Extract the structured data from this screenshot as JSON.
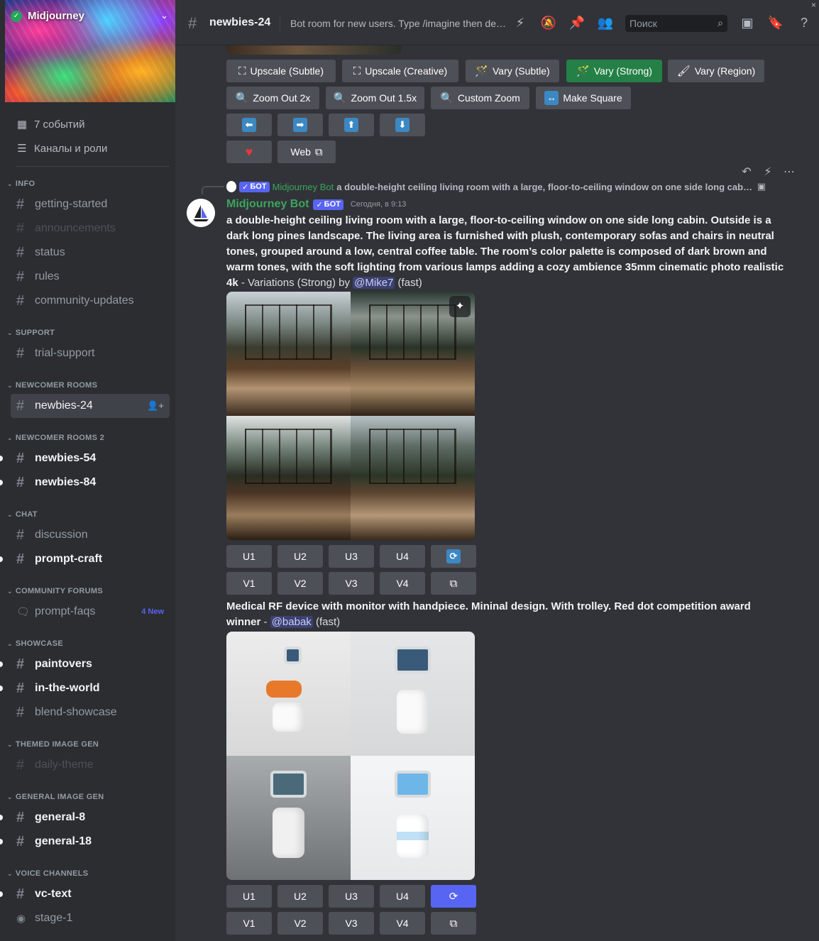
{
  "sidebar": {
    "server_name": "Midjourney",
    "top_items": [
      {
        "label": "7 событий",
        "icon": "calendar-icon"
      },
      {
        "label": "Каналы и роли",
        "icon": "channels-roles-icon"
      }
    ],
    "categories": [
      {
        "name": "INFO",
        "channels": [
          {
            "label": "getting-started",
            "state": "normal"
          },
          {
            "label": "announcements",
            "state": "muted"
          },
          {
            "label": "status",
            "state": "normal"
          },
          {
            "label": "rules",
            "state": "normal"
          },
          {
            "label": "community-updates",
            "state": "normal"
          }
        ]
      },
      {
        "name": "SUPPORT",
        "channels": [
          {
            "label": "trial-support",
            "state": "normal"
          }
        ]
      },
      {
        "name": "NEWCOMER ROOMS",
        "channels": [
          {
            "label": "newbies-24",
            "state": "active"
          }
        ]
      },
      {
        "name": "NEWCOMER ROOMS 2",
        "channels": [
          {
            "label": "newbies-54",
            "state": "unread"
          },
          {
            "label": "newbies-84",
            "state": "unread"
          }
        ]
      },
      {
        "name": "CHAT",
        "channels": [
          {
            "label": "discussion",
            "state": "normal"
          },
          {
            "label": "prompt-craft",
            "state": "unread"
          }
        ]
      },
      {
        "name": "COMMUNITY FORUMS",
        "channels": [
          {
            "label": "prompt-faqs",
            "state": "normal",
            "badge": "4 New"
          }
        ]
      },
      {
        "name": "SHOWCASE",
        "channels": [
          {
            "label": "paintovers",
            "state": "unread"
          },
          {
            "label": "in-the-world",
            "state": "unread"
          },
          {
            "label": "blend-showcase",
            "state": "normal"
          }
        ]
      },
      {
        "name": "THEMED IMAGE GEN",
        "channels": [
          {
            "label": "daily-theme",
            "state": "muted"
          }
        ]
      },
      {
        "name": "GENERAL IMAGE GEN",
        "channels": [
          {
            "label": "general-8",
            "state": "unread"
          },
          {
            "label": "general-18",
            "state": "unread"
          }
        ]
      },
      {
        "name": "VOICE CHANNELS",
        "channels": [
          {
            "label": "vc-text",
            "state": "unread"
          },
          {
            "label": "stage-1",
            "state": "normal"
          }
        ]
      }
    ]
  },
  "header": {
    "channel_name": "newbies-24",
    "topic": "Bot room for new users. Type /imagine then describe what you want to draw.",
    "search_placeholder": "Поиск"
  },
  "prev_message": {
    "buttons_row1": [
      "Upscale (Subtle)",
      "Upscale (Creative)",
      "Vary (Subtle)",
      "Vary (Strong)",
      "Vary (Region)"
    ],
    "buttons_row2": [
      "Zoom Out 2x",
      "Zoom Out 1.5x",
      "Custom Zoom",
      "Make Square"
    ],
    "arrows": [
      "⬅",
      "➡",
      "⬆",
      "⬇"
    ],
    "web_label": "Web"
  },
  "message1": {
    "reply_author": "Midjourney Bot",
    "reply_text": "a double-height ceiling living room with a large, floor-to-ceiling window on one side long cabin. Outside is a",
    "bot_tag": "БОТ",
    "author": "Midjourney Bot",
    "timestamp": "Сегодня, в 9:13",
    "prompt": "a double-height ceiling living room with a large, floor-to-ceiling window on one side long cabin. Outside is a dark long pines landscape. The living area is furnished with plush, contemporary sofas and chairs in neutral tones, grouped around a low, central coffee table. The room’s color palette is composed of dark brown and warm tones, with the soft lighting from various lamps adding a cozy ambience 35mm cinematic photo realistic 4k",
    "suffix_pre": " - Variations (Strong) by ",
    "mention": "@Mike7",
    "suffix_post": " (fast)",
    "u_buttons": [
      "U1",
      "U2",
      "U3",
      "U4"
    ],
    "v_buttons": [
      "V1",
      "V2",
      "V3",
      "V4"
    ]
  },
  "message2": {
    "prompt": "Medical RF device with monitor with handpiece. Mininal design. With trolley. Red dot competition award winner",
    "suffix_pre": " - ",
    "mention": "@babak",
    "suffix_post": " (fast)",
    "u_buttons": [
      "U1",
      "U2",
      "U3",
      "U4"
    ],
    "v_buttons": [
      "V1",
      "V2",
      "V3",
      "V4"
    ]
  },
  "colors": {
    "accent": "#5865f2",
    "green": "#248046",
    "bot_name": "#3ba55d"
  }
}
